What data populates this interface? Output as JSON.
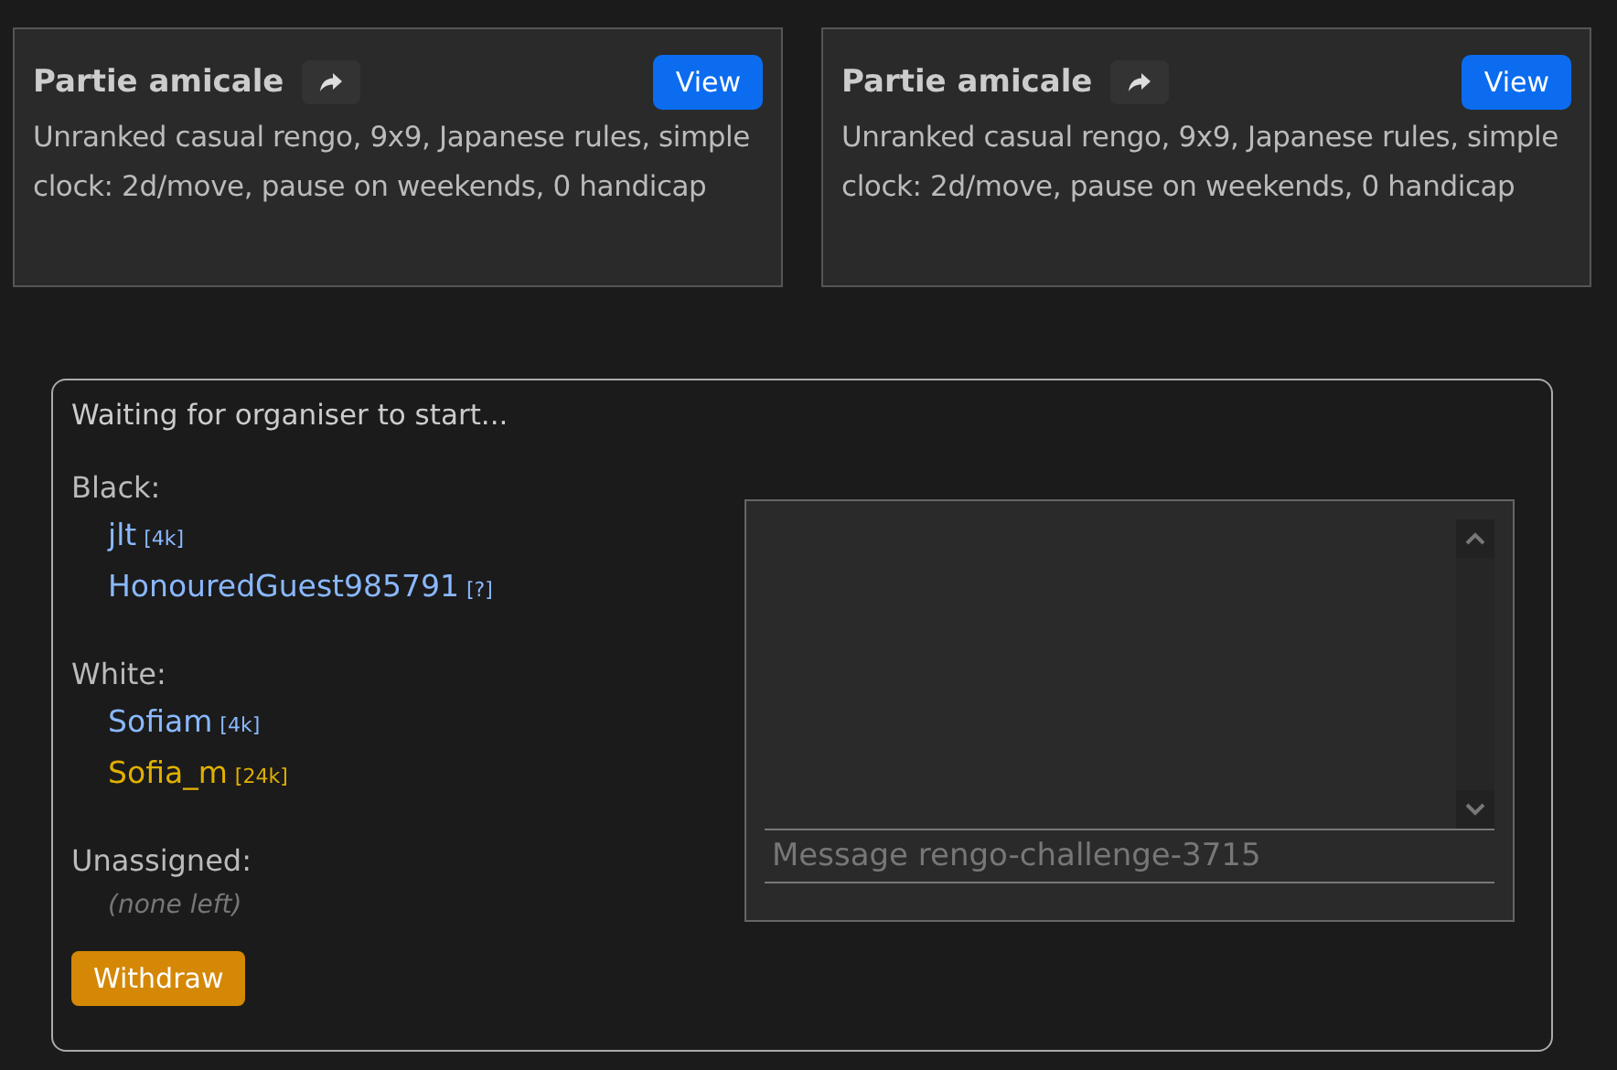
{
  "cards": [
    {
      "title": "Partie amicale",
      "button": "View",
      "description": "Unranked casual rengo, 9x9, Japanese rules, simple clock: 2d/move, pause on weekends, 0 handicap"
    },
    {
      "title": "Partie amicale",
      "button": "View",
      "description": "Unranked casual rengo, 9x9, Japanese rules, simple clock: 2d/move, pause on weekends, 0 handicap"
    }
  ],
  "panel": {
    "status": "Waiting for organiser to start...",
    "teams": [
      {
        "label": "Black:",
        "players": [
          {
            "name": "jlt",
            "rank": "[4k]",
            "color": "#8ab8ff"
          },
          {
            "name": "HonouredGuest985791",
            "rank": "[?]",
            "color": "#8ab8ff"
          }
        ]
      },
      {
        "label": "White:",
        "players": [
          {
            "name": "Sofiam",
            "rank": "[4k]",
            "color": "#8ab8ff"
          },
          {
            "name": "Sofia_m",
            "rank": "[24k]",
            "color": "#e0b000"
          }
        ]
      }
    ],
    "unassigned": {
      "label": "Unassigned:",
      "note": "(none left)"
    },
    "button": "Withdraw",
    "chat": {
      "placeholder": "Message rengo-challenge-3715"
    }
  }
}
